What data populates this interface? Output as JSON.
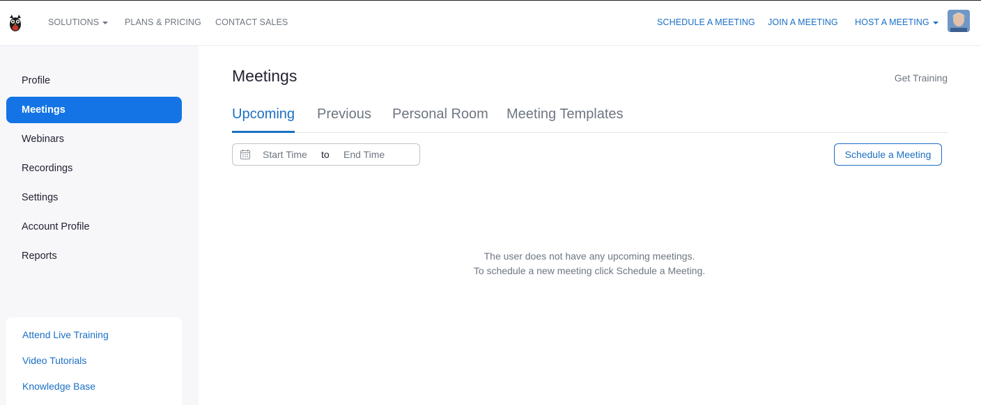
{
  "topnav": {
    "left_items": [
      "SOLUTIONS",
      "PLANS & PRICING",
      "CONTACT SALES"
    ],
    "right_items": [
      "SCHEDULE A MEETING",
      "JOIN A MEETING",
      "HOST A MEETING"
    ],
    "accent_color": "#1a6fc4",
    "logo_icon": "owl-logo-icon",
    "avatar_icon": "user-avatar"
  },
  "sidebar": {
    "items": [
      {
        "label": "Profile",
        "active": false
      },
      {
        "label": "Meetings",
        "active": true
      },
      {
        "label": "Webinars",
        "active": false
      },
      {
        "label": "Recordings",
        "active": false
      },
      {
        "label": "Settings",
        "active": false
      },
      {
        "label": "Account Profile",
        "active": false
      },
      {
        "label": "Reports",
        "active": false
      }
    ],
    "links": [
      "Attend Live Training",
      "Video Tutorials",
      "Knowledge Base"
    ],
    "active_color": "#1474e6"
  },
  "main": {
    "title": "Meetings",
    "get_training": "Get Training",
    "tabs": [
      {
        "label": "Upcoming",
        "active": true
      },
      {
        "label": "Previous",
        "active": false
      },
      {
        "label": "Personal Room",
        "active": false
      },
      {
        "label": "Meeting Templates",
        "active": false
      }
    ],
    "date_range": {
      "start_placeholder": "Start Time",
      "separator": "to",
      "end_placeholder": "End Time"
    },
    "schedule_button": "Schedule a Meeting",
    "empty_line1": "The user does not have any upcoming meetings.",
    "empty_line2": "To schedule a new meeting click Schedule a Meeting."
  }
}
